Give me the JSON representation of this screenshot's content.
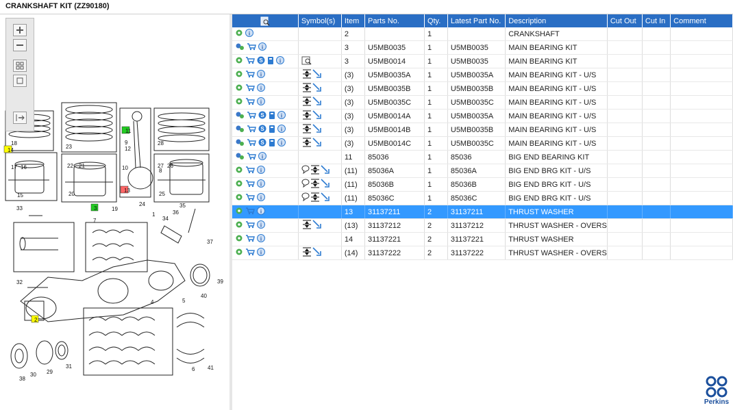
{
  "window": {
    "title": "CRANKSHAFT KIT (ZZ90180)"
  },
  "toolbox": {
    "buttons": [
      {
        "name": "zoom-in-icon"
      },
      {
        "name": "zoom-out-icon"
      },
      {
        "name": "fit-page-icon"
      },
      {
        "name": "actual-size-icon"
      },
      {
        "name": "export-icon"
      }
    ]
  },
  "diagram": {
    "callouts": [
      "1",
      "2",
      "3",
      "4",
      "5",
      "6",
      "7",
      "8",
      "9",
      "10",
      "11",
      "12",
      "13",
      "14",
      "15",
      "16",
      "17",
      "18",
      "19",
      "20",
      "21",
      "22",
      "23",
      "24",
      "25",
      "26",
      "27",
      "28",
      "29",
      "30",
      "31",
      "32",
      "33",
      "34",
      "35",
      "36",
      "37",
      "38",
      "39",
      "40",
      "41"
    ]
  },
  "table": {
    "columns": {
      "tools": "",
      "symbols": "Symbol(s)",
      "item": "Item",
      "parts_no": "Parts No.",
      "qty": "Qty.",
      "latest": "Latest Part No.",
      "description": "Description",
      "cut_out": "Cut Out",
      "cut_in": "Cut In",
      "comment": "Comment"
    },
    "rows": [
      {
        "icons": [
          "gear-icon",
          "info-icon"
        ],
        "symbols": [],
        "item": "2",
        "parts_no": "",
        "qty": "1",
        "latest": "",
        "description": "CRANKSHAFT",
        "selected": false
      },
      {
        "icons": [
          "config-icon",
          "cart-icon",
          "info-icon"
        ],
        "symbols": [],
        "item": "3",
        "parts_no": "U5MB0035",
        "qty": "1",
        "latest": "U5MB0035",
        "description": "MAIN BEARING KIT",
        "selected": false
      },
      {
        "icons": [
          "gear-icon",
          "cart-icon",
          "service-icon",
          "book-icon",
          "info-icon"
        ],
        "symbols": [
          "book-search-icon"
        ],
        "item": "3",
        "parts_no": "U5MB0014",
        "qty": "1",
        "latest": "U5MB0035",
        "description": "MAIN BEARING KIT",
        "selected": false
      },
      {
        "icons": [
          "gear-icon",
          "cart-icon",
          "info-icon"
        ],
        "symbols": [
          "undersize-icon",
          "replaced-by-icon"
        ],
        "item": "(3)",
        "parts_no": "U5MB0035A",
        "qty": "1",
        "latest": "U5MB0035A",
        "description": "MAIN BEARING KIT - U/S",
        "selected": false
      },
      {
        "icons": [
          "gear-icon",
          "cart-icon",
          "info-icon"
        ],
        "symbols": [
          "undersize-icon",
          "replaced-by-icon"
        ],
        "item": "(3)",
        "parts_no": "U5MB0035B",
        "qty": "1",
        "latest": "U5MB0035B",
        "description": "MAIN BEARING KIT - U/S",
        "selected": false
      },
      {
        "icons": [
          "gear-icon",
          "cart-icon",
          "info-icon"
        ],
        "symbols": [
          "undersize-icon",
          "replaced-by-icon"
        ],
        "item": "(3)",
        "parts_no": "U5MB0035C",
        "qty": "1",
        "latest": "U5MB0035C",
        "description": "MAIN BEARING KIT - U/S",
        "selected": false
      },
      {
        "icons": [
          "config-icon",
          "cart-icon",
          "service-icon",
          "book-icon",
          "info-icon"
        ],
        "symbols": [
          "undersize-icon",
          "replaced-by-icon"
        ],
        "item": "(3)",
        "parts_no": "U5MB0014A",
        "qty": "1",
        "latest": "U5MB0035A",
        "description": "MAIN BEARING KIT - U/S",
        "selected": false
      },
      {
        "icons": [
          "config-icon",
          "cart-icon",
          "service-icon",
          "book-icon",
          "info-icon"
        ],
        "symbols": [
          "undersize-icon",
          "replaced-by-icon"
        ],
        "item": "(3)",
        "parts_no": "U5MB0014B",
        "qty": "1",
        "latest": "U5MB0035B",
        "description": "MAIN BEARING KIT - U/S",
        "selected": false
      },
      {
        "icons": [
          "config-icon",
          "cart-icon",
          "service-icon",
          "book-icon",
          "info-icon"
        ],
        "symbols": [
          "undersize-icon",
          "replaced-by-icon"
        ],
        "item": "(3)",
        "parts_no": "U5MB0014C",
        "qty": "1",
        "latest": "U5MB0035C",
        "description": "MAIN BEARING KIT - U/S",
        "selected": false
      },
      {
        "icons": [
          "config-icon",
          "cart-icon",
          "info-icon"
        ],
        "symbols": [],
        "item": "11",
        "parts_no": "85036",
        "qty": "1",
        "latest": "85036",
        "description": "BIG END BEARING KIT",
        "selected": false
      },
      {
        "icons": [
          "gear-icon",
          "cart-icon",
          "info-icon"
        ],
        "symbols": [
          "comment-icon",
          "undersize-icon",
          "replaced-by-icon"
        ],
        "item": "(11)",
        "parts_no": "85036A",
        "qty": "1",
        "latest": "85036A",
        "description": "BIG END BRG KIT - U/S",
        "selected": false
      },
      {
        "icons": [
          "gear-icon",
          "cart-icon",
          "info-icon"
        ],
        "symbols": [
          "comment-icon",
          "undersize-icon",
          "replaced-by-icon"
        ],
        "item": "(11)",
        "parts_no": "85036B",
        "qty": "1",
        "latest": "85036B",
        "description": "BIG END BRG KIT - U/S",
        "selected": false
      },
      {
        "icons": [
          "gear-icon",
          "cart-icon",
          "info-icon"
        ],
        "symbols": [
          "comment-icon",
          "undersize-icon",
          "replaced-by-icon"
        ],
        "item": "(11)",
        "parts_no": "85036C",
        "qty": "1",
        "latest": "85036C",
        "description": "BIG END BRG KIT - U/S",
        "selected": false
      },
      {
        "icons": [
          "gear-icon",
          "cart-icon",
          "info-icon"
        ],
        "symbols": [],
        "item": "13",
        "parts_no": "31137211",
        "qty": "2",
        "latest": "31137211",
        "description": "THRUST WASHER",
        "selected": true
      },
      {
        "icons": [
          "gear-icon",
          "cart-icon",
          "info-icon"
        ],
        "symbols": [
          "undersize-icon",
          "replaced-by-icon"
        ],
        "item": "(13)",
        "parts_no": "31137212",
        "qty": "2",
        "latest": "31137212",
        "description": "THRUST WASHER - OVERS",
        "selected": false
      },
      {
        "icons": [
          "gear-icon",
          "cart-icon",
          "info-icon"
        ],
        "symbols": [],
        "item": "14",
        "parts_no": "31137221",
        "qty": "2",
        "latest": "31137221",
        "description": "THRUST WASHER",
        "selected": false
      },
      {
        "icons": [
          "gear-icon",
          "cart-icon",
          "info-icon"
        ],
        "symbols": [
          "undersize-icon",
          "replaced-by-icon"
        ],
        "item": "(14)",
        "parts_no": "31137222",
        "qty": "2",
        "latest": "31137222",
        "description": "THRUST WASHER - OVERS",
        "selected": false
      }
    ]
  },
  "brand": {
    "logo_label": "Perkins",
    "color": "#1b4f9c"
  },
  "colors": {
    "header": "#2a6ec4",
    "selected_row": "#3399ff",
    "highlight_green": "#22cc22",
    "highlight_yellow": "#ffff00",
    "highlight_red": "#ff6666"
  }
}
